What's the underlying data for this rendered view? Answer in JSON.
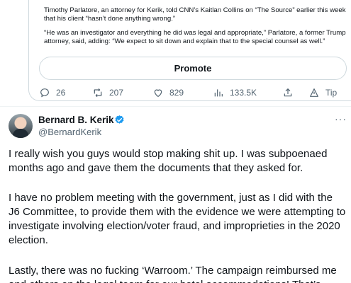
{
  "quoted_article": {
    "paragraph_1": "Timothy Parlatore, an attorney for Kerik, told CNN’s Kaitlan Collins on “The Source” earlier this week that his client “hasn’t done anything wrong.”",
    "paragraph_2": "“He was an investigator and everything he did was legal and appropriate,” Parlatore, a former Trump attorney, said, adding: “We expect to sit down and explain that to the special counsel as well.”"
  },
  "promote": {
    "label": "Promote"
  },
  "actions": {
    "replies": "26",
    "retweets": "207",
    "likes": "829",
    "views": "133.5K",
    "tip": "Tip"
  },
  "tweet": {
    "author_name": "Bernard B. Kerik",
    "handle": "@BernardKerik",
    "more": "···",
    "paragraphs": [
      "I really wish you guys would stop making shit up. I was subpoenaed months ago and gave them the documents that they asked for.",
      "I have no problem meeting with the government, just as I did with the J6 Committee, to provide them with the evidence we were attempting to investigate involving election/voter fraud, and improprieties in the 2020 election.",
      "Lastly, there was no fucking  ‘Warroom.’ The campaign reimbursed me and others on the legal team for our hotel accommodations! That’s"
    ]
  },
  "colors": {
    "verified_badge": "#1d9bf0",
    "muted_text": "#536471",
    "border": "#cfd9de"
  },
  "icons": [
    "reply-icon",
    "retweet-icon",
    "like-icon",
    "views-icon",
    "share-icon",
    "tip-icon",
    "verified-badge-icon",
    "more-icon"
  ]
}
